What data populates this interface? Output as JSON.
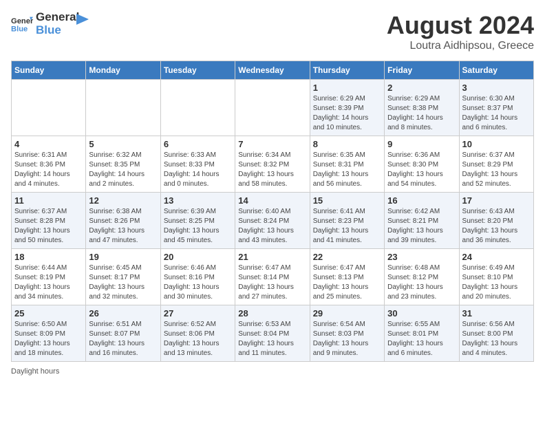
{
  "logo": {
    "text_general": "General",
    "text_blue": "Blue"
  },
  "title": "August 2024",
  "subtitle": "Loutra Aidhipsou, Greece",
  "weekdays": [
    "Sunday",
    "Monday",
    "Tuesday",
    "Wednesday",
    "Thursday",
    "Friday",
    "Saturday"
  ],
  "footer": "Daylight hours",
  "weeks": [
    [
      {
        "day": "",
        "info": ""
      },
      {
        "day": "",
        "info": ""
      },
      {
        "day": "",
        "info": ""
      },
      {
        "day": "",
        "info": ""
      },
      {
        "day": "1",
        "info": "Sunrise: 6:29 AM\nSunset: 8:39 PM\nDaylight: 14 hours and 10 minutes."
      },
      {
        "day": "2",
        "info": "Sunrise: 6:29 AM\nSunset: 8:38 PM\nDaylight: 14 hours and 8 minutes."
      },
      {
        "day": "3",
        "info": "Sunrise: 6:30 AM\nSunset: 8:37 PM\nDaylight: 14 hours and 6 minutes."
      }
    ],
    [
      {
        "day": "4",
        "info": "Sunrise: 6:31 AM\nSunset: 8:36 PM\nDaylight: 14 hours and 4 minutes."
      },
      {
        "day": "5",
        "info": "Sunrise: 6:32 AM\nSunset: 8:35 PM\nDaylight: 14 hours and 2 minutes."
      },
      {
        "day": "6",
        "info": "Sunrise: 6:33 AM\nSunset: 8:33 PM\nDaylight: 14 hours and 0 minutes."
      },
      {
        "day": "7",
        "info": "Sunrise: 6:34 AM\nSunset: 8:32 PM\nDaylight: 13 hours and 58 minutes."
      },
      {
        "day": "8",
        "info": "Sunrise: 6:35 AM\nSunset: 8:31 PM\nDaylight: 13 hours and 56 minutes."
      },
      {
        "day": "9",
        "info": "Sunrise: 6:36 AM\nSunset: 8:30 PM\nDaylight: 13 hours and 54 minutes."
      },
      {
        "day": "10",
        "info": "Sunrise: 6:37 AM\nSunset: 8:29 PM\nDaylight: 13 hours and 52 minutes."
      }
    ],
    [
      {
        "day": "11",
        "info": "Sunrise: 6:37 AM\nSunset: 8:28 PM\nDaylight: 13 hours and 50 minutes."
      },
      {
        "day": "12",
        "info": "Sunrise: 6:38 AM\nSunset: 8:26 PM\nDaylight: 13 hours and 47 minutes."
      },
      {
        "day": "13",
        "info": "Sunrise: 6:39 AM\nSunset: 8:25 PM\nDaylight: 13 hours and 45 minutes."
      },
      {
        "day": "14",
        "info": "Sunrise: 6:40 AM\nSunset: 8:24 PM\nDaylight: 13 hours and 43 minutes."
      },
      {
        "day": "15",
        "info": "Sunrise: 6:41 AM\nSunset: 8:23 PM\nDaylight: 13 hours and 41 minutes."
      },
      {
        "day": "16",
        "info": "Sunrise: 6:42 AM\nSunset: 8:21 PM\nDaylight: 13 hours and 39 minutes."
      },
      {
        "day": "17",
        "info": "Sunrise: 6:43 AM\nSunset: 8:20 PM\nDaylight: 13 hours and 36 minutes."
      }
    ],
    [
      {
        "day": "18",
        "info": "Sunrise: 6:44 AM\nSunset: 8:19 PM\nDaylight: 13 hours and 34 minutes."
      },
      {
        "day": "19",
        "info": "Sunrise: 6:45 AM\nSunset: 8:17 PM\nDaylight: 13 hours and 32 minutes."
      },
      {
        "day": "20",
        "info": "Sunrise: 6:46 AM\nSunset: 8:16 PM\nDaylight: 13 hours and 30 minutes."
      },
      {
        "day": "21",
        "info": "Sunrise: 6:47 AM\nSunset: 8:14 PM\nDaylight: 13 hours and 27 minutes."
      },
      {
        "day": "22",
        "info": "Sunrise: 6:47 AM\nSunset: 8:13 PM\nDaylight: 13 hours and 25 minutes."
      },
      {
        "day": "23",
        "info": "Sunrise: 6:48 AM\nSunset: 8:12 PM\nDaylight: 13 hours and 23 minutes."
      },
      {
        "day": "24",
        "info": "Sunrise: 6:49 AM\nSunset: 8:10 PM\nDaylight: 13 hours and 20 minutes."
      }
    ],
    [
      {
        "day": "25",
        "info": "Sunrise: 6:50 AM\nSunset: 8:09 PM\nDaylight: 13 hours and 18 minutes."
      },
      {
        "day": "26",
        "info": "Sunrise: 6:51 AM\nSunset: 8:07 PM\nDaylight: 13 hours and 16 minutes."
      },
      {
        "day": "27",
        "info": "Sunrise: 6:52 AM\nSunset: 8:06 PM\nDaylight: 13 hours and 13 minutes."
      },
      {
        "day": "28",
        "info": "Sunrise: 6:53 AM\nSunset: 8:04 PM\nDaylight: 13 hours and 11 minutes."
      },
      {
        "day": "29",
        "info": "Sunrise: 6:54 AM\nSunset: 8:03 PM\nDaylight: 13 hours and 9 minutes."
      },
      {
        "day": "30",
        "info": "Sunrise: 6:55 AM\nSunset: 8:01 PM\nDaylight: 13 hours and 6 minutes."
      },
      {
        "day": "31",
        "info": "Sunrise: 6:56 AM\nSunset: 8:00 PM\nDaylight: 13 hours and 4 minutes."
      }
    ]
  ]
}
